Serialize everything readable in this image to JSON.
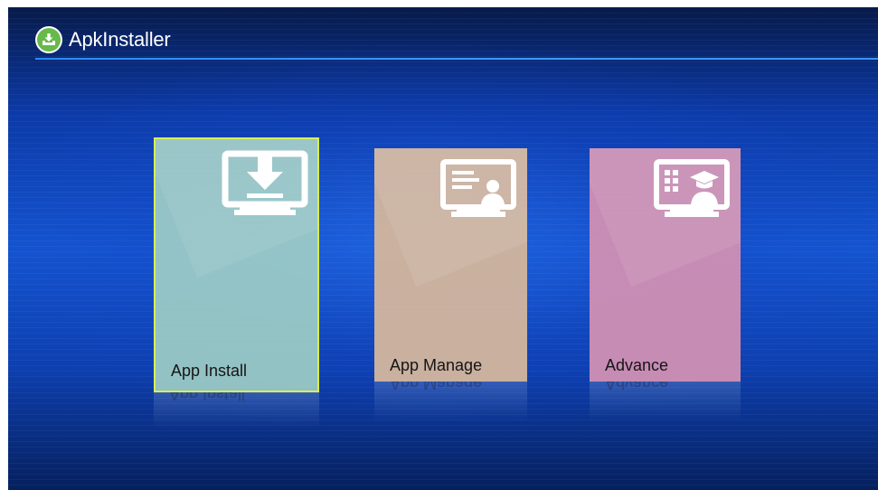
{
  "app": {
    "title": "ApkInstaller",
    "logo_icon": "download-tray-icon",
    "accent_color": "#3b9cff"
  },
  "tiles": [
    {
      "label": "App Install",
      "icon": "download-monitor-icon",
      "color": "#9ecdc6",
      "focused": true
    },
    {
      "label": "App Manage",
      "icon": "profile-card-monitor-icon",
      "color": "#d0b49e",
      "focused": false
    },
    {
      "label": "Advance",
      "icon": "grid-graduation-monitor-icon",
      "color": "#cd8eb4",
      "focused": false
    }
  ]
}
